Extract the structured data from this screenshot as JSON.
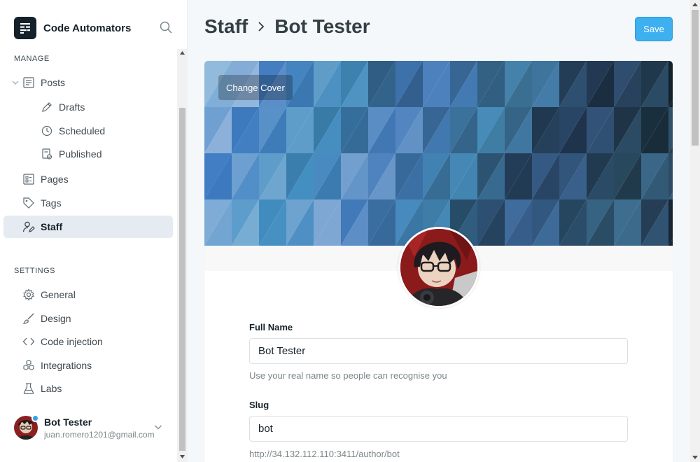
{
  "sidebar": {
    "brand": "Code Automators",
    "manage_label": "MANAGE",
    "settings_label": "SETTINGS",
    "manage_items": [
      {
        "label": "Posts",
        "icon": "posts-icon"
      },
      {
        "label": "Drafts",
        "icon": "pencil-icon"
      },
      {
        "label": "Scheduled",
        "icon": "clock-icon"
      },
      {
        "label": "Published",
        "icon": "published-icon"
      },
      {
        "label": "Pages",
        "icon": "pages-icon"
      },
      {
        "label": "Tags",
        "icon": "tag-icon"
      },
      {
        "label": "Staff",
        "icon": "staff-icon"
      }
    ],
    "settings_items": [
      {
        "label": "General",
        "icon": "gear-icon"
      },
      {
        "label": "Design",
        "icon": "brush-icon"
      },
      {
        "label": "Code injection",
        "icon": "code-icon"
      },
      {
        "label": "Integrations",
        "icon": "integrations-icon"
      },
      {
        "label": "Labs",
        "icon": "flask-icon"
      }
    ],
    "user": {
      "name": "Bot Tester",
      "email": "juan.romero1201@gmail.com"
    }
  },
  "header": {
    "crumb_parent": "Staff",
    "crumb_current": "Bot Tester",
    "save_label": "Save"
  },
  "profile": {
    "change_cover_label": "Change Cover",
    "full_name": {
      "label": "Full Name",
      "value": "Bot Tester",
      "hint": "Use your real name so people can recognise you"
    },
    "slug": {
      "label": "Slug",
      "value": "bot",
      "hint": "http://34.132.112.110:3411/author/bot"
    }
  },
  "colors": {
    "accent": "#3eb0ef",
    "active_nav_bg": "#e5ebf1",
    "online_dot": "#30a3e6"
  }
}
